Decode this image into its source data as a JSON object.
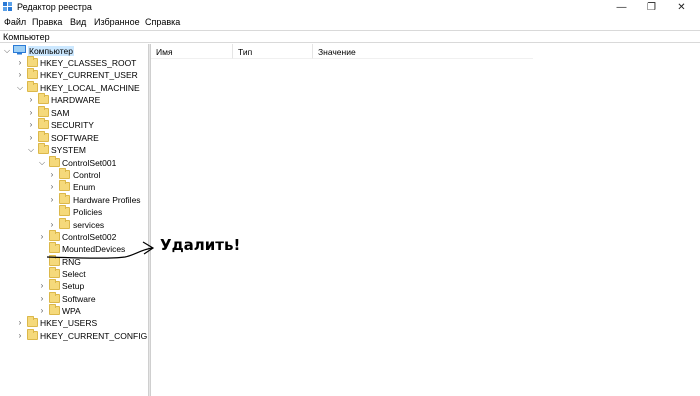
{
  "window": {
    "title": "Редактор реестра",
    "controls": {
      "minimize": "—",
      "maximize": "❐",
      "close": "✕"
    }
  },
  "menu": {
    "items": [
      "Файл",
      "Правка",
      "Вид",
      "Избранное",
      "Справка"
    ]
  },
  "address": {
    "path": "Компьютер"
  },
  "tree": {
    "root": "Компьютер",
    "hkcr": "HKEY_CLASSES_ROOT",
    "hkcu": "HKEY_CURRENT_USER",
    "hklm": "HKEY_LOCAL_MACHINE",
    "hklm_children": {
      "hardware": "HARDWARE",
      "sam": "SAM",
      "security": "SECURITY",
      "software": "SOFTWARE",
      "system": "SYSTEM"
    },
    "system_children": {
      "controlset001": "ControlSet001",
      "controlset002": "ControlSet002",
      "mounteddevices": "MountedDevices",
      "rng": "RNG",
      "select": "Select",
      "setup": "Setup",
      "software": "Software",
      "wpa": "WPA"
    },
    "controlset001_children": {
      "control": "Control",
      "enum": "Enum",
      "hardware_profiles": "Hardware Profiles",
      "policies": "Policies",
      "services": "services"
    },
    "hku": "HKEY_USERS",
    "hkcc": "HKEY_CURRENT_CONFIG"
  },
  "list": {
    "columns": [
      "Имя",
      "Тип",
      "Значение"
    ]
  },
  "annotation": {
    "text": "Удалить!"
  },
  "colors": {
    "folder": "#f5d97b",
    "selection": "#cce8ff",
    "icon_blue": "#2a7ad6"
  }
}
